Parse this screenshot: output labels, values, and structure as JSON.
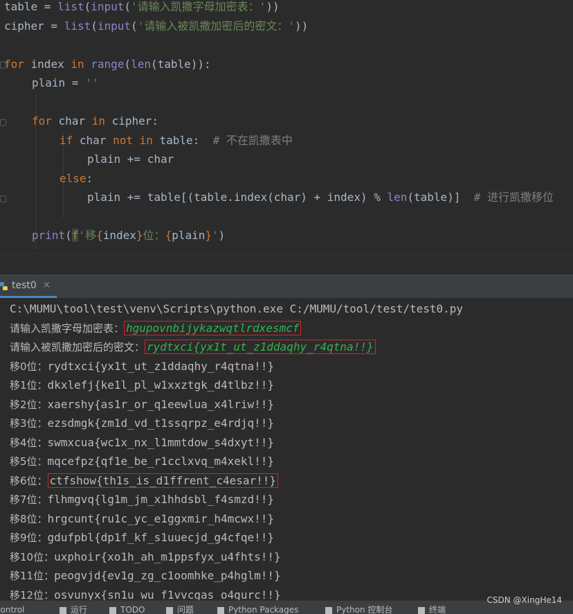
{
  "editor": {
    "lines": {
      "l1": {
        "a": "table = ",
        "b": "list",
        "c": "(",
        "d": "input",
        "e": "(",
        "f": "'请输入凯撒字母加密表：'",
        "g": "))"
      },
      "l2": {
        "a": "cipher = ",
        "b": "list",
        "c": "(",
        "d": "input",
        "e": "(",
        "f": "'请输入被凯撒加密后的密文：'",
        "g": "))"
      },
      "l3": {
        "a": "for",
        "b": " index ",
        "c": "in",
        "d": " ",
        "e": "range",
        "f": "(",
        "g": "len",
        "h": "(table)):"
      },
      "l4": {
        "a": "plain = ",
        "b": "''"
      },
      "l5": {
        "a": "for",
        "b": " char ",
        "c": "in",
        "d": " cipher:"
      },
      "l6": {
        "a": "if",
        "b": " char ",
        "c": "not in",
        "d": " table:",
        "e": "  ",
        "f": "# 不在凯撒表中"
      },
      "l7": {
        "a": "plain += char"
      },
      "l8": {
        "a": "else",
        "b": ":"
      },
      "l9": {
        "a": "plain += table[(table.index(char) + index) % ",
        "b": "len",
        "c": "(table)]",
        "d": "  ",
        "e": "# 进行凯撒移位"
      },
      "l10": {
        "a": "print",
        "b": "(",
        "c": "f",
        "d": "'移",
        "e": "{",
        "f": "index",
        "g": "}",
        "h": "位：",
        "i": "{",
        "j": "plain",
        "k": "}",
        "l": "'",
        "m": ")"
      }
    }
  },
  "run_tab": {
    "label": "test0",
    "close": "×"
  },
  "console": {
    "command": "C:\\MUMU\\tool\\test\\venv\\Scripts\\python.exe C:/MUMU/tool/test/test0.py",
    "prompt1": "请输入凯撒字母加密表：",
    "input1": "hgupovnbijykazwqtlrdxesmcf",
    "prompt2": "请输入被凯撒加密后的密文：",
    "input2": "rydtxci{yx1t_ut_z1ddaqhy_r4qtna!!}",
    "shifts": [
      {
        "prefix": "移0位：",
        "text": "rydtxci{yx1t_ut_z1ddaqhy_r4qtna!!}"
      },
      {
        "prefix": "移1位：",
        "text": "dkxlefj{ke1l_pl_w1xxztgk_d4tlbz!!}"
      },
      {
        "prefix": "移2位：",
        "text": "xaershy{as1r_or_q1eewlua_x4lriw!!}"
      },
      {
        "prefix": "移3位：",
        "text": "ezsdmgk{zm1d_vd_t1ssqrpz_e4rdjq!!}"
      },
      {
        "prefix": "移4位：",
        "text": "swmxcua{wc1x_nx_l1mmtdow_s4dxyt!!}"
      },
      {
        "prefix": "移5位：",
        "text": "mqcefpz{qf1e_be_r1cclxvq_m4xekl!!}"
      },
      {
        "prefix": "移6位：",
        "text": "ctfshow{th1s_is_d1ffrent_c4esar!!}"
      },
      {
        "prefix": "移7位：",
        "text": "flhmgvq{lg1m_jm_x1hhdsbl_f4smzd!!}"
      },
      {
        "prefix": "移8位：",
        "text": "hrgcunt{ru1c_yc_e1ggxmir_h4mcwx!!}"
      },
      {
        "prefix": "移9位：",
        "text": "gdufpbl{dp1f_kf_s1uuecjd_g4cfqe!!}"
      },
      {
        "prefix": "移10位：",
        "text": "uxphoir{xo1h_ah_m1ppsfyx_u4fhts!!}"
      },
      {
        "prefix": "移11位：",
        "text": "peogvjd{ev1g_zg_c1oomhke_p4hglm!!}"
      },
      {
        "prefix": "移12位：",
        "text": "osvunyx{sn1u_wu_f1vvcgas_o4gurc!!}"
      }
    ]
  },
  "statusbar": {
    "items": [
      "Control",
      "运行",
      "TODO",
      "问题",
      "Python Packages",
      "Python 控制台",
      "终端"
    ]
  },
  "watermark": "CSDN @XingHe14",
  "colors": {
    "keyword": "#cc7832",
    "builtin": "#8888c6",
    "string": "#6a8759",
    "comment": "#808080",
    "console_input": "#34b24b",
    "highlight_box": "#e02020",
    "tab_accent": "#4a88c7"
  }
}
